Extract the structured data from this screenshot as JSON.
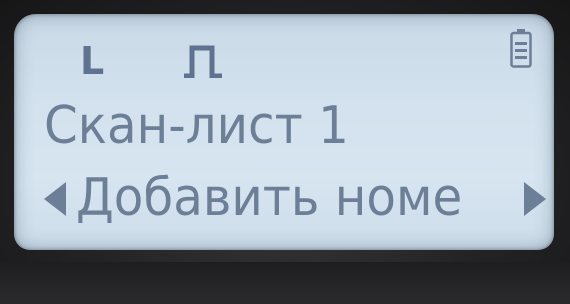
{
  "status": {
    "mode_letter": "L",
    "pulse_icon": "pulse-waveform-icon",
    "battery_icon": "battery-icon"
  },
  "display": {
    "line1": "Скан-лист 1",
    "line2": "Добавить номе",
    "left_arrow_icon": "left-arrow-icon",
    "right_arrow_icon": "right-arrow-icon"
  },
  "colors": {
    "lcd_background": "#d3e2ee",
    "lcd_text": "#6d7f96",
    "bezel": "#232325"
  }
}
